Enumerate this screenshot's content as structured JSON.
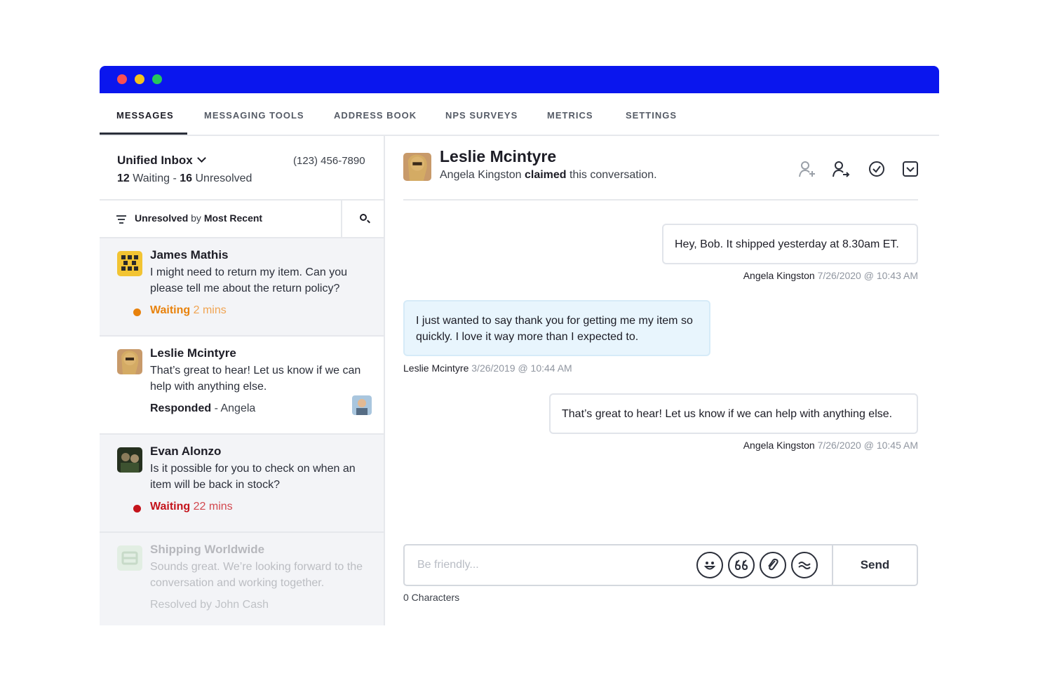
{
  "nav": {
    "tabs": [
      "MESSAGES",
      "MESSAGING TOOLS",
      "ADDRESS BOOK",
      "NPS SURVEYS",
      "METRICS",
      "SETTINGS"
    ],
    "active": "MESSAGES"
  },
  "inbox": {
    "title": "Unified Inbox",
    "phone": "(123) 456-7890",
    "waiting_count": "12",
    "waiting_label": "Waiting -",
    "unresolved_count": "16",
    "unresolved_label": "Unresolved"
  },
  "filter": {
    "status": "Unresolved",
    "by": "by",
    "sort": "Most Recent"
  },
  "conversations": [
    {
      "name": "James Mathis",
      "snippet": "I might need to return my item. Can you please tell me about the return policy?",
      "status": "Waiting",
      "time": "2 mins",
      "status_color": "#e8820c"
    },
    {
      "name": "Leslie Mcintyre",
      "snippet": "That’s great to hear! Let us know if we can help with anything else.",
      "status": "Responded",
      "agent": "- Angela"
    },
    {
      "name": "Evan Alonzo",
      "snippet": "Is it possible for you to check on when an item will be back in stock?",
      "status": "Waiting",
      "time": "22 mins",
      "status_color": "#c4131b"
    },
    {
      "name": "Shipping Worldwide",
      "snippet": "Sounds great. We’re looking forward to the conversation and working together.",
      "status": "Resolved by John Cash"
    }
  ],
  "chat": {
    "name": "Leslie Mcintyre",
    "claim_agent": "Angela Kingston",
    "claim_word": "claimed",
    "claim_rest": "this conversation.",
    "icons": [
      "add-user-icon",
      "transfer-user-icon",
      "resolve-check-icon",
      "dropdown-box-icon"
    ]
  },
  "messages": [
    {
      "text": "Hey, Bob. It shipped yesterday at 8.30am ET.",
      "author": "Angela Kingston",
      "stamp": "7/26/2020 @ 10:43 AM",
      "direction": "out"
    },
    {
      "text": "I just wanted to say thank you for getting me my item so quickly. I love it way more than I expected to.",
      "author": "Leslie Mcintyre",
      "stamp": "3/26/2019 @ 10:44 AM",
      "direction": "in"
    },
    {
      "text": "That’s great to hear! Let us know if we can help with anything else.",
      "author": "Angela Kingston",
      "stamp": "7/26/2020 @ 10:45 AM",
      "direction": "out"
    }
  ],
  "composer": {
    "placeholder": "Be friendly...",
    "icons": [
      "emoji-icon",
      "quote-icon",
      "attach-icon",
      "template-icon"
    ],
    "send": "Send",
    "char_count": "0 Characters"
  },
  "colors": {
    "titlebar": "#0a16ee",
    "waiting_orange": "#e8820c",
    "waiting_red": "#c4131b",
    "incoming_bubble": "#e8f5fd"
  }
}
